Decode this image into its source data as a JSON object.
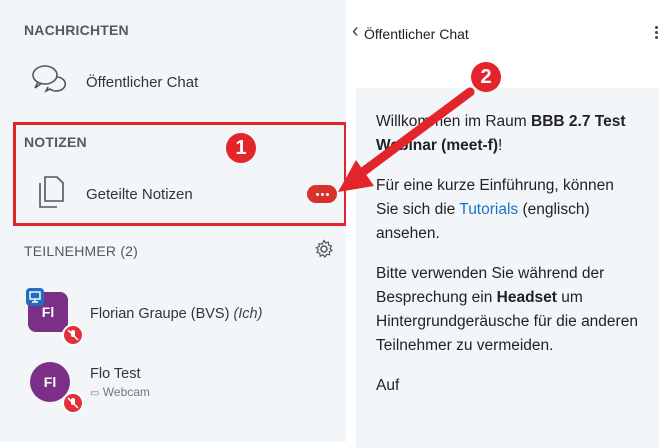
{
  "nachrichten": {
    "title": "NACHRICHTEN",
    "public_chat": "Öffentlicher Chat"
  },
  "notizen": {
    "title": "NOTIZEN",
    "shared_notes": "Geteilte Notizen"
  },
  "teilnehmer": {
    "title": "TEILNEHMER (2)",
    "users": [
      {
        "initials": "Fl",
        "name": "Florian Graupe (BVS)",
        "suffix": "(Ich)"
      },
      {
        "initials": "Fl",
        "name": "Flo Test",
        "status": "Webcam"
      }
    ]
  },
  "annotations": {
    "one": "1",
    "two": "2"
  },
  "chat": {
    "header": "Öffentlicher Chat",
    "welcome_1a": "Willkommen im Raum ",
    "welcome_1b": "BBB 2.7 Test Webinar (meet-f)",
    "welcome_1c": "!",
    "welcome_2a": "Für eine kurze Einführung, können Sie sich die ",
    "welcome_2b": "Tutorials",
    "welcome_2c": " (englisch) ansehen.",
    "welcome_3a": "Bitte verwenden Sie während der Besprechung ein ",
    "welcome_3b": "Headset",
    "welcome_3c": " um Hintergrundgeräusche für die anderen Teilnehmer zu vermeiden.",
    "welcome_4": "Auf "
  },
  "colors": {
    "accent": "#e3242b",
    "link": "#1a73c9",
    "avatar": "#7c2f86",
    "panel": "#f3f6f9"
  }
}
